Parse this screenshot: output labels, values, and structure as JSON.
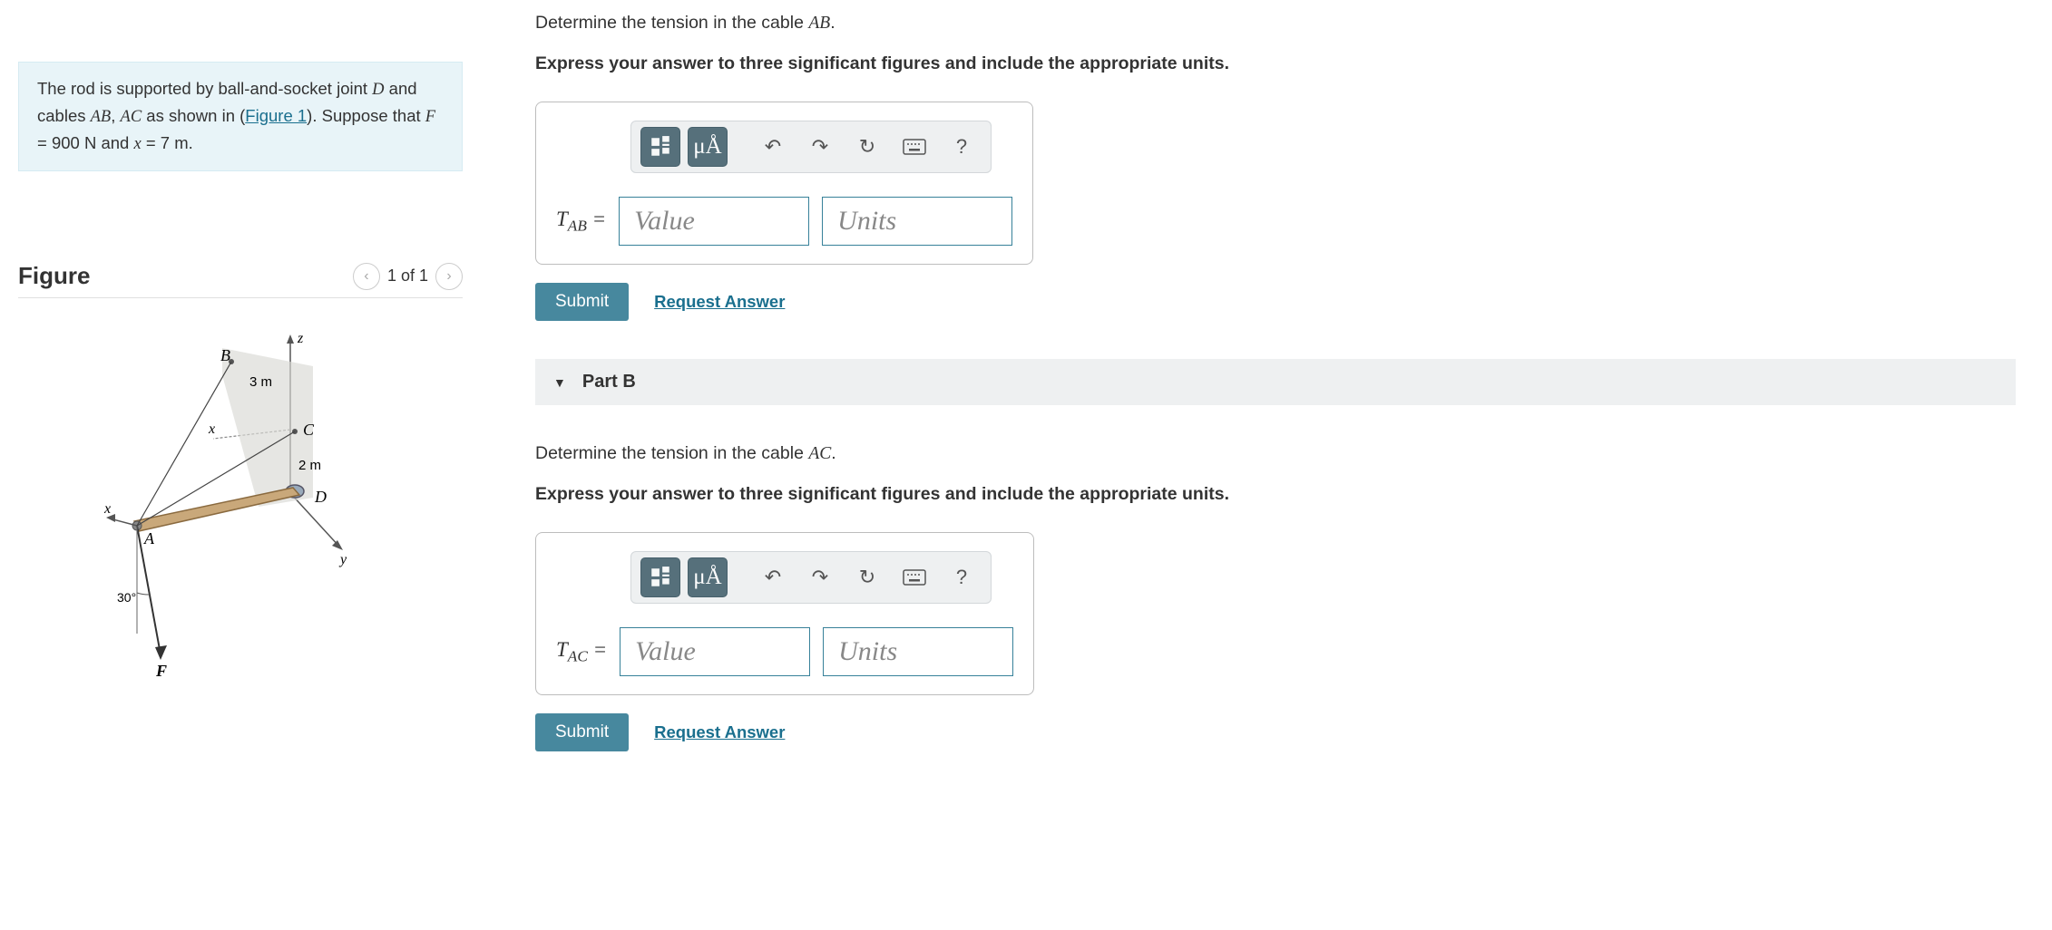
{
  "problem": {
    "text_prefix": "The rod is supported by ball-and-socket joint ",
    "joint": "D",
    "text_mid1": " and cables ",
    "cable1": "AB",
    "text_mid2": ", ",
    "cable2": "AC",
    "text_mid3": " as shown in (",
    "figure_link": "Figure 1",
    "text_mid4": "). Suppose that ",
    "given_f_label": "F",
    "given_f_eq": "= 900 N",
    "given_x_label": "x",
    "given_x_eq": "= 7 m",
    "text_and": " and ",
    "text_end": "."
  },
  "figure": {
    "title": "Figure",
    "nav_label": "1 of 1",
    "labels": {
      "B": "B",
      "C": "C",
      "D": "D",
      "A": "A",
      "F": "F",
      "z": "z",
      "x": "x",
      "y": "y",
      "x_axis_left": "x",
      "d_bc": "3 m",
      "d_cd": "2 m",
      "angle": "30°"
    }
  },
  "partA": {
    "prompt_pre": "Determine the tension in the cable ",
    "prompt_var": "AB",
    "prompt_end": ".",
    "hint": "Express your answer to three significant figures and include the appropriate units.",
    "toolbar": {
      "mu": "μÅ",
      "help": "?"
    },
    "var_prefix": "T",
    "var_sub": "AB",
    "equals": " = ",
    "value_placeholder": "Value",
    "units_placeholder": "Units",
    "submit": "Submit",
    "request": "Request Answer"
  },
  "partB": {
    "header": "Part B",
    "prompt_pre": "Determine the tension in the cable ",
    "prompt_var": "AC",
    "prompt_end": ".",
    "hint": "Express your answer to three significant figures and include the appropriate units.",
    "toolbar": {
      "mu": "μÅ",
      "help": "?"
    },
    "var_prefix": "T",
    "var_sub": "AC",
    "equals": " = ",
    "value_placeholder": "Value",
    "units_placeholder": "Units",
    "submit": "Submit",
    "request": "Request Answer"
  }
}
